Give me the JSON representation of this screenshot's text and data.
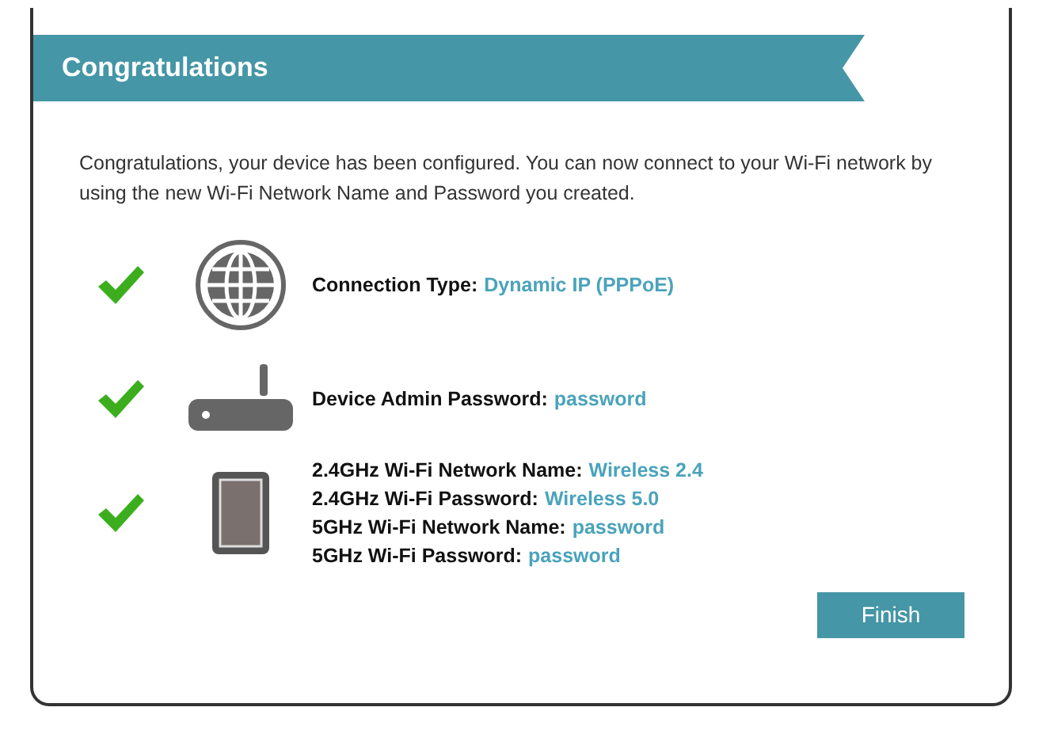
{
  "banner": {
    "title": "Congratulations"
  },
  "message": "Congratulations, your device has been configured. You can now connect to your Wi-Fi network by using the new Wi-Fi Network Name and Password you created.",
  "items": [
    {
      "kind": "globe",
      "done": true,
      "fields": [
        {
          "label": "Connection Type:",
          "value": "Dynamic IP (PPPoE)"
        }
      ]
    },
    {
      "kind": "router",
      "done": true,
      "fields": [
        {
          "label": "Device Admin Password:",
          "value": "password"
        }
      ]
    },
    {
      "kind": "tablet",
      "done": true,
      "fields": [
        {
          "label": "2.4GHz Wi-Fi Network Name:",
          "value": "Wireless 2.4"
        },
        {
          "label": "2.4GHz Wi-Fi Password:",
          "value": "Wireless 5.0"
        },
        {
          "label": "5GHz Wi-Fi Network Name:",
          "value": "password"
        },
        {
          "label": "5GHz Wi-Fi Password:",
          "value": "password"
        }
      ]
    }
  ],
  "buttons": [
    {
      "label": "Finish"
    }
  ]
}
